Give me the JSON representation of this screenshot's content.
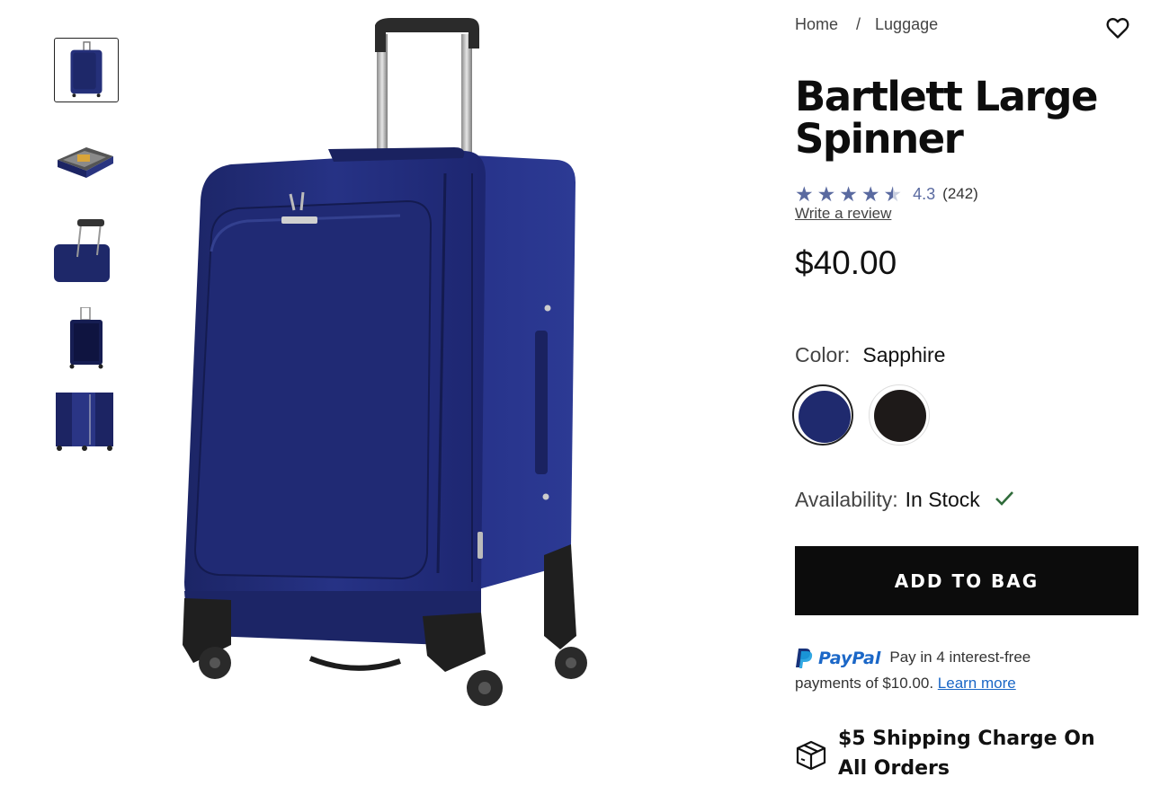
{
  "breadcrumb": {
    "home": "Home",
    "separator": "/",
    "current": "Luggage"
  },
  "product": {
    "title": "Bartlett Large Spinner",
    "rating": {
      "score": "4.3",
      "count": "(242)",
      "stars_value": 4.3,
      "stars_max": 5
    },
    "write_review": "Write a review",
    "price": "$40.00"
  },
  "color": {
    "label": "Color:",
    "selected": "Sapphire",
    "swatches": [
      {
        "name": "Sapphire",
        "hex": "#1f2a6e",
        "selected": true
      },
      {
        "name": "Black",
        "hex": "#1e1a19",
        "selected": false
      }
    ]
  },
  "availability": {
    "label": "Availability:",
    "value": "In Stock"
  },
  "add_to_bag": "ADD TO BAG",
  "paypal": {
    "brand": "PayPal",
    "line1": "Pay in 4 interest-free",
    "line2": "payments of $10.00.",
    "learn_more": "Learn more"
  },
  "shipping": {
    "text": "$5 Shipping Charge On All Orders"
  },
  "icons": {
    "favorite": "heart-icon",
    "shipping": "package-icon",
    "availability": "check-icon"
  },
  "thumbnails": [
    {
      "name": "front-view"
    },
    {
      "name": "open-interior-view"
    },
    {
      "name": "handle-closeup-view"
    },
    {
      "name": "back-view"
    },
    {
      "name": "expanded-side-view"
    }
  ],
  "colors": {
    "star": "#5a6aa0",
    "button": "#0c0c0c",
    "paypal": "#1b67c7",
    "check": "#2f6b3a"
  }
}
